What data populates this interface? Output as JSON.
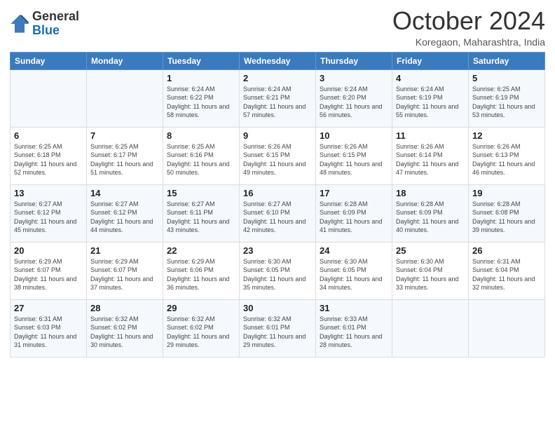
{
  "logo": {
    "line1": "General",
    "line2": "Blue"
  },
  "title": "October 2024",
  "subtitle": "Koregaon, Maharashtra, India",
  "header_days": [
    "Sunday",
    "Monday",
    "Tuesday",
    "Wednesday",
    "Thursday",
    "Friday",
    "Saturday"
  ],
  "weeks": [
    [
      {
        "day": "",
        "info": ""
      },
      {
        "day": "",
        "info": ""
      },
      {
        "day": "1",
        "info": "Sunrise: 6:24 AM\nSunset: 6:22 PM\nDaylight: 11 hours and 58 minutes."
      },
      {
        "day": "2",
        "info": "Sunrise: 6:24 AM\nSunset: 6:21 PM\nDaylight: 11 hours and 57 minutes."
      },
      {
        "day": "3",
        "info": "Sunrise: 6:24 AM\nSunset: 6:20 PM\nDaylight: 11 hours and 56 minutes."
      },
      {
        "day": "4",
        "info": "Sunrise: 6:24 AM\nSunset: 6:19 PM\nDaylight: 11 hours and 55 minutes."
      },
      {
        "day": "5",
        "info": "Sunrise: 6:25 AM\nSunset: 6:19 PM\nDaylight: 11 hours and 53 minutes."
      }
    ],
    [
      {
        "day": "6",
        "info": "Sunrise: 6:25 AM\nSunset: 6:18 PM\nDaylight: 11 hours and 52 minutes."
      },
      {
        "day": "7",
        "info": "Sunrise: 6:25 AM\nSunset: 6:17 PM\nDaylight: 11 hours and 51 minutes."
      },
      {
        "day": "8",
        "info": "Sunrise: 6:25 AM\nSunset: 6:16 PM\nDaylight: 11 hours and 50 minutes."
      },
      {
        "day": "9",
        "info": "Sunrise: 6:26 AM\nSunset: 6:15 PM\nDaylight: 11 hours and 49 minutes."
      },
      {
        "day": "10",
        "info": "Sunrise: 6:26 AM\nSunset: 6:15 PM\nDaylight: 11 hours and 48 minutes."
      },
      {
        "day": "11",
        "info": "Sunrise: 6:26 AM\nSunset: 6:14 PM\nDaylight: 11 hours and 47 minutes."
      },
      {
        "day": "12",
        "info": "Sunrise: 6:26 AM\nSunset: 6:13 PM\nDaylight: 11 hours and 46 minutes."
      }
    ],
    [
      {
        "day": "13",
        "info": "Sunrise: 6:27 AM\nSunset: 6:12 PM\nDaylight: 11 hours and 45 minutes."
      },
      {
        "day": "14",
        "info": "Sunrise: 6:27 AM\nSunset: 6:12 PM\nDaylight: 11 hours and 44 minutes."
      },
      {
        "day": "15",
        "info": "Sunrise: 6:27 AM\nSunset: 6:11 PM\nDaylight: 11 hours and 43 minutes."
      },
      {
        "day": "16",
        "info": "Sunrise: 6:27 AM\nSunset: 6:10 PM\nDaylight: 11 hours and 42 minutes."
      },
      {
        "day": "17",
        "info": "Sunrise: 6:28 AM\nSunset: 6:09 PM\nDaylight: 11 hours and 41 minutes."
      },
      {
        "day": "18",
        "info": "Sunrise: 6:28 AM\nSunset: 6:09 PM\nDaylight: 11 hours and 40 minutes."
      },
      {
        "day": "19",
        "info": "Sunrise: 6:28 AM\nSunset: 6:08 PM\nDaylight: 11 hours and 39 minutes."
      }
    ],
    [
      {
        "day": "20",
        "info": "Sunrise: 6:29 AM\nSunset: 6:07 PM\nDaylight: 11 hours and 38 minutes."
      },
      {
        "day": "21",
        "info": "Sunrise: 6:29 AM\nSunset: 6:07 PM\nDaylight: 11 hours and 37 minutes."
      },
      {
        "day": "22",
        "info": "Sunrise: 6:29 AM\nSunset: 6:06 PM\nDaylight: 11 hours and 36 minutes."
      },
      {
        "day": "23",
        "info": "Sunrise: 6:30 AM\nSunset: 6:05 PM\nDaylight: 11 hours and 35 minutes."
      },
      {
        "day": "24",
        "info": "Sunrise: 6:30 AM\nSunset: 6:05 PM\nDaylight: 11 hours and 34 minutes."
      },
      {
        "day": "25",
        "info": "Sunrise: 6:30 AM\nSunset: 6:04 PM\nDaylight: 11 hours and 33 minutes."
      },
      {
        "day": "26",
        "info": "Sunrise: 6:31 AM\nSunset: 6:04 PM\nDaylight: 11 hours and 32 minutes."
      }
    ],
    [
      {
        "day": "27",
        "info": "Sunrise: 6:31 AM\nSunset: 6:03 PM\nDaylight: 11 hours and 31 minutes."
      },
      {
        "day": "28",
        "info": "Sunrise: 6:32 AM\nSunset: 6:02 PM\nDaylight: 11 hours and 30 minutes."
      },
      {
        "day": "29",
        "info": "Sunrise: 6:32 AM\nSunset: 6:02 PM\nDaylight: 11 hours and 29 minutes."
      },
      {
        "day": "30",
        "info": "Sunrise: 6:32 AM\nSunset: 6:01 PM\nDaylight: 11 hours and 29 minutes."
      },
      {
        "day": "31",
        "info": "Sunrise: 6:33 AM\nSunset: 6:01 PM\nDaylight: 11 hours and 28 minutes."
      },
      {
        "day": "",
        "info": ""
      },
      {
        "day": "",
        "info": ""
      }
    ]
  ]
}
